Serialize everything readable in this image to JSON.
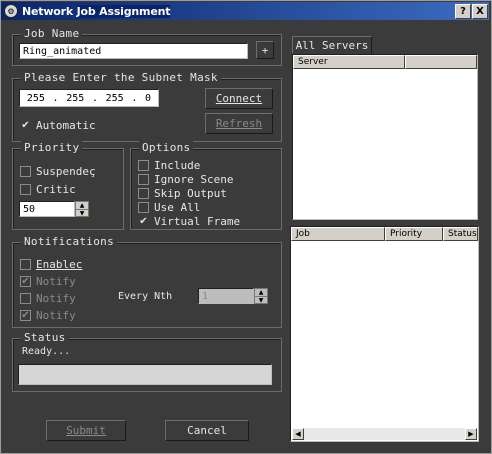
{
  "window": {
    "icon": "gear-icon",
    "title_part1": "Network ",
    "title_part2": "Job Assignment",
    "help_label": "?",
    "close_label": "X"
  },
  "job_name": {
    "legend": "Job Name",
    "value": "Ring_animated",
    "add_label": "+"
  },
  "subnet": {
    "legend": "Please Enter the Subnet Mask",
    "octets": [
      "255",
      "255",
      "255",
      "0"
    ],
    "connect_label": "Connect",
    "refresh_label": "Refresh",
    "automatic_label": "Automatic",
    "automatic_checked": true
  },
  "priority": {
    "legend": "Priority",
    "suspended_label": "Suspendeç",
    "critical_label": "Critic",
    "value": "50"
  },
  "options": {
    "legend": "Options",
    "items": [
      {
        "label": "Include",
        "checked": false
      },
      {
        "label": "Ignore Scene",
        "checked": false
      },
      {
        "label": "Skip Output",
        "checked": false
      },
      {
        "label": "Use All",
        "checked": false
      },
      {
        "label": "Virtual Frame",
        "checked": true
      }
    ]
  },
  "notifications": {
    "legend": "Notifications",
    "enabled_label": "Enablec",
    "notify_items": [
      {
        "label": "Notify",
        "checked": true
      },
      {
        "label": "Notify",
        "checked": false
      },
      {
        "label": "Notify",
        "checked": true
      }
    ],
    "every_nth_label": "Every Nth",
    "every_nth_value": "1"
  },
  "status": {
    "legend": "Status",
    "text": "Ready..."
  },
  "actions": {
    "submit_label": "Submit",
    "cancel_label": "Cancel"
  },
  "servers": {
    "tab_label": "All Servers",
    "columns": [
      "Server",
      ""
    ]
  },
  "jobs": {
    "columns": [
      "Job",
      "Priority",
      "Status"
    ]
  },
  "colors": {
    "background": "#3b3b3b",
    "titlebar_start": "#0a246a",
    "titlebar_end": "#3d6cc0"
  }
}
